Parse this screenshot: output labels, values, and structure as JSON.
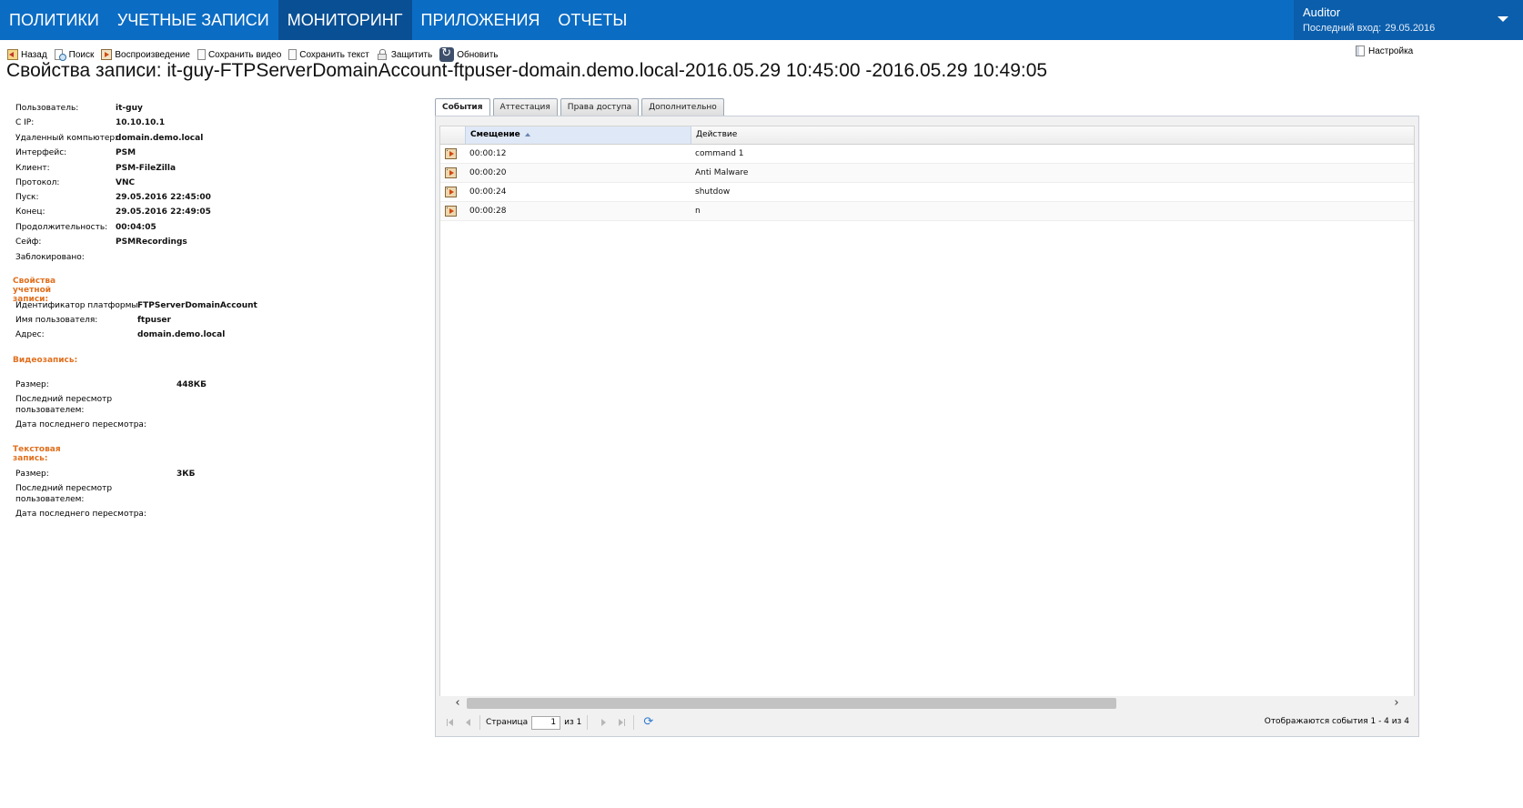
{
  "nav": {
    "items": [
      {
        "label": "ПОЛИТИКИ",
        "active": false
      },
      {
        "label": "УЧЕТНЫЕ ЗАПИСИ",
        "active": false
      },
      {
        "label": "МОНИТОРИНГ",
        "active": true
      },
      {
        "label": "ПРИЛОЖЕНИЯ",
        "active": false
      },
      {
        "label": "ОТЧЕТЫ",
        "active": false
      }
    ],
    "user": {
      "name": "Auditor",
      "last_login_label": "Последний вход:",
      "last_login_date": "29.05.2016"
    }
  },
  "toolbar": {
    "back": "Назад",
    "search": "Поиск",
    "play": "Воспроизведение",
    "save_video": "Сохранить видео",
    "save_text": "Сохранить текст",
    "protect": "Защитить",
    "refresh": "Обновить",
    "settings": "Настройка"
  },
  "page_title": "Свойства записи: it-guy-FTPServerDomainAccount-ftpuser-domain.demo.local-2016.05.29 10:45:00 -2016.05.29 10:49:05",
  "session": [
    {
      "label": "Пользователь:",
      "value": "it-guy"
    },
    {
      "label": "С IP:",
      "value": "10.10.10.1"
    },
    {
      "label": "Удаленный компьютер:",
      "value": "domain.demo.local"
    },
    {
      "label": "Интерфейс:",
      "value": "PSM"
    },
    {
      "label": "Клиент:",
      "value": "PSM-FileZilla"
    },
    {
      "label": "Протокол:",
      "value": "VNC"
    },
    {
      "label": "Пуск:",
      "value": "29.05.2016 22:45:00"
    },
    {
      "label": "Конец:",
      "value": "29.05.2016 22:49:05"
    },
    {
      "label": "Продолжительность:",
      "value": "00:04:05"
    },
    {
      "label": "Сейф:",
      "value": "PSMRecordings"
    },
    {
      "label": "Заблокировано:",
      "value": ""
    }
  ],
  "account": {
    "heading": "Свойства учетной записи:",
    "rows": [
      {
        "label": "Идентификатор платформы:",
        "value": "FTPServerDomainAccount"
      },
      {
        "label": "Имя пользователя:",
        "value": "ftpuser"
      },
      {
        "label": "Адрес:",
        "value": "domain.demo.local"
      }
    ]
  },
  "video": {
    "heading": "Видеозапись:",
    "size_label": "Размер:",
    "size": "448КБ",
    "viewed_by_label_1": "Последний пересмотр",
    "viewed_by_label_2": "пользователем:",
    "viewed_date_label": "Дата последнего пересмотра:"
  },
  "text": {
    "heading": "Текстовая запись:",
    "size_label": "Размер:",
    "size": "3КБ",
    "viewed_by_label_1": "Последний пересмотр",
    "viewed_by_label_2": "пользователем:",
    "viewed_date_label": "Дата последнего пересмотра:"
  },
  "tabs": [
    {
      "label": "События",
      "active": true
    },
    {
      "label": "Аттестация",
      "active": false
    },
    {
      "label": "Права доступа",
      "active": false
    },
    {
      "label": "Дополнительно",
      "active": false
    }
  ],
  "grid": {
    "columns": {
      "offset": "Смещение",
      "action": "Действие"
    },
    "sort": "ascending",
    "rows": [
      {
        "offset": "00:00:12",
        "action": "command 1",
        "icon": "recording-icon"
      },
      {
        "offset": "00:00:20",
        "action": "Anti Malware",
        "icon": "recording-icon"
      },
      {
        "offset": "00:00:24",
        "action": "shutdow",
        "icon": "recording-icon"
      },
      {
        "offset": "00:00:28",
        "action": "n",
        "icon": "recording-icon"
      }
    ]
  },
  "pager": {
    "page_label": "Страница",
    "page_value": "1",
    "of_label": "из 1",
    "status": "Отображаются события 1 - 4 из 4"
  },
  "colors": {
    "nav_bg": "#0b6cc4",
    "nav_active": "#094f94",
    "section_heading": "#e0701f"
  }
}
